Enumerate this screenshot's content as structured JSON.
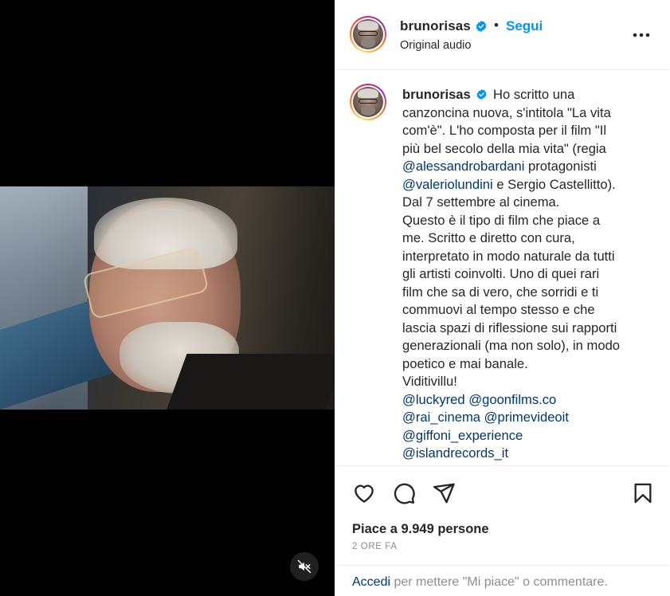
{
  "post": {
    "author": "brunorisas",
    "follow_label": "Segui",
    "separator": "•",
    "audio": "Original audio"
  },
  "caption": {
    "username": "brunorisas",
    "lines": [
      "Ho scritto una",
      "canzoncina nuova, s'intitola \"La vita",
      "com'è\". L'ho composta per il film \"Il",
      "più bel secolo della mia vita\" (regia"
    ],
    "mention_1": "@alessandrobardani",
    "after_mention_1": " protagonisti",
    "mention_2": "@valeriolundini",
    "after_mention_2": " e Sergio Castellitto).",
    "body_lines": [
      "Dal 7 settembre al cinema.",
      "Questo è il tipo di film che piace a",
      "me. Scritto e diretto con cura,",
      "interpretato in modo naturale da tutti",
      "gli artisti coinvolti. Uno di quei rari",
      "film che sa di vero, che sorridi e ti",
      "commuovi al tempo stesso e che",
      "lascia spazi di riflessione sui rapporti",
      "generazionali (ma non solo), in modo",
      "poetico e mai banale.",
      "Viditivillu!"
    ],
    "tags": [
      "@luckyred",
      "@goonfilms.co",
      "@rai_cinema",
      "@primevideoit",
      "@giffoni_experience",
      "@islandrecords_it"
    ]
  },
  "engagement": {
    "likes": "Piace a 9.949 persone",
    "time_ago": "2 ORE FA"
  },
  "login_prompt": {
    "link": "Accedi",
    "text": " per mettere \"Mi piace\" o commentare."
  },
  "icons": {
    "verified": "verified-badge-icon",
    "more": "more-options-icon",
    "like": "heart-icon",
    "comment": "comment-icon",
    "share": "share-icon",
    "save": "bookmark-icon",
    "mute": "muted-speaker-icon"
  },
  "colors": {
    "accent": "#0095f6",
    "mention": "#00376b",
    "verified": "#0095f6",
    "muted_text": "#8e8e8e",
    "text": "#262626"
  }
}
